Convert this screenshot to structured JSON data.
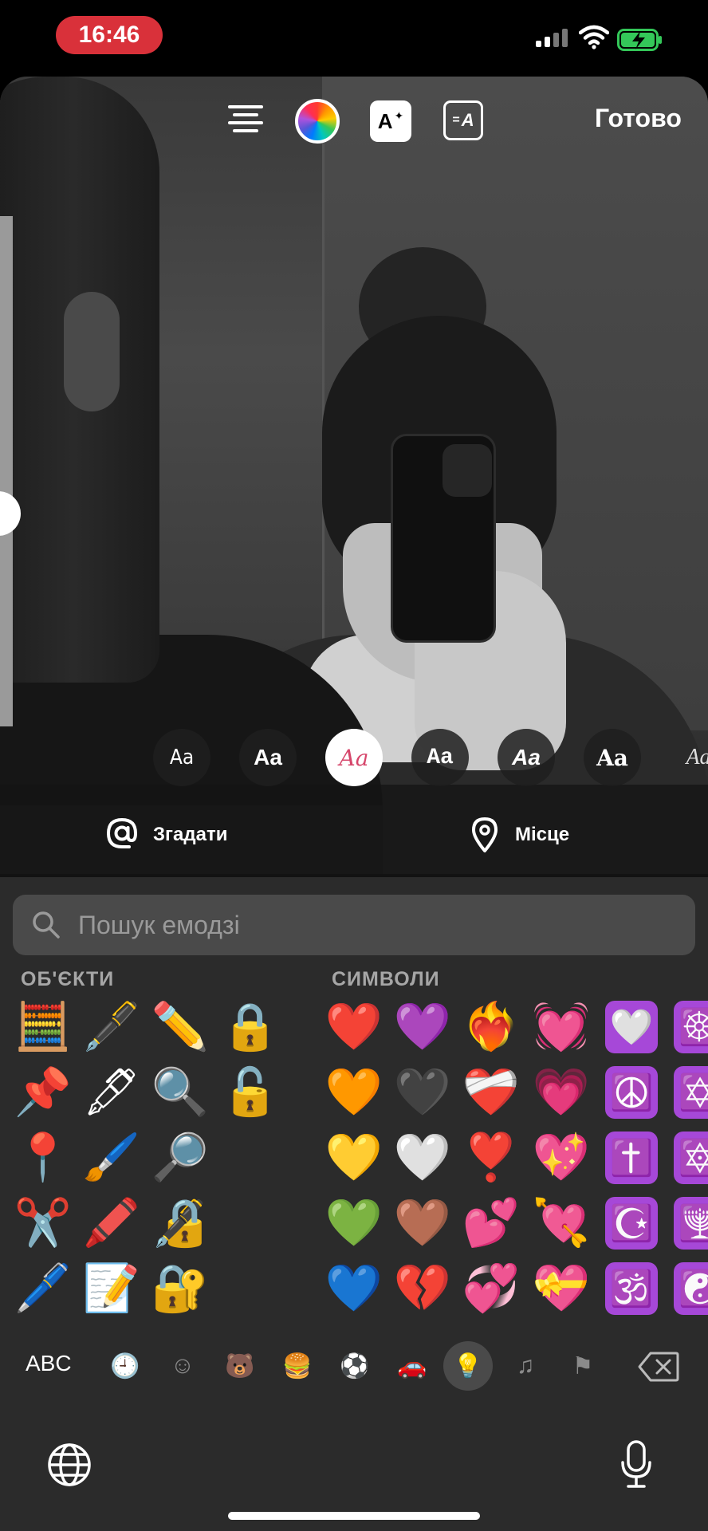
{
  "status_bar": {
    "time": "16:46",
    "icons": [
      "signal-icon",
      "wifi-icon",
      "battery-charging-icon"
    ],
    "time_pill_color": "#d9313a",
    "battery_color": "#34c759"
  },
  "toolbar": {
    "icons": [
      "text-align-icon",
      "color-wheel-icon",
      "text-effects-icon",
      "text-background-icon"
    ],
    "effects_glyph": "A",
    "bg_glyph": "A",
    "done_label": "Готово"
  },
  "font_styles": {
    "labels": [
      "Aa",
      "Aa",
      "Aa",
      "Aa",
      "Aa",
      "Aa",
      "Aa"
    ],
    "selected_index": 2,
    "selected_color": "#d6466b"
  },
  "actions": {
    "mention_label": "Згадати",
    "location_label": "Місце"
  },
  "emoji_search": {
    "placeholder": "Пошук емодзі"
  },
  "sections": {
    "objects_label": "ОБ'ЄКТИ",
    "symbols_label": "СИМВОЛИ"
  },
  "objects_emoji": [
    "🧮",
    "🖋️",
    "✏️",
    "🔒",
    "📌",
    "🖋",
    "🔍",
    "🔓",
    "📍",
    "🖌️",
    "🔎",
    "",
    "✂️",
    "🖍️",
    "🔏",
    "",
    "🖊️",
    "📝",
    "🔐",
    ""
  ],
  "symbols_emoji": [
    "❤️",
    "💜",
    "❤️‍🔥",
    "💓",
    "🤍",
    "☸️",
    "🧡",
    "🖤",
    "❤️‍🩹",
    "💗",
    "☮️",
    "✡️",
    "💛",
    "🤍",
    "❣️",
    "💖",
    "✝️",
    "🔯",
    "💚",
    "🤎",
    "💕",
    "💘",
    "☪️",
    "🕎",
    "💙",
    "💔",
    "💞",
    "💝",
    "🕉️",
    "☯️"
  ],
  "symbol_box_color": "#a648d8",
  "keyboard_bar": {
    "abc_label": "ABC",
    "categories": [
      "recents-icon",
      "smileys-icon",
      "animals-icon",
      "food-icon",
      "activity-icon",
      "travel-icon",
      "objects-icon",
      "symbols-icon",
      "flags-icon"
    ],
    "selected_category": "objects-icon",
    "delete_icon": "delete-icon"
  },
  "bottom": {
    "globe_icon": "globe-icon",
    "mic_icon": "microphone-icon"
  }
}
